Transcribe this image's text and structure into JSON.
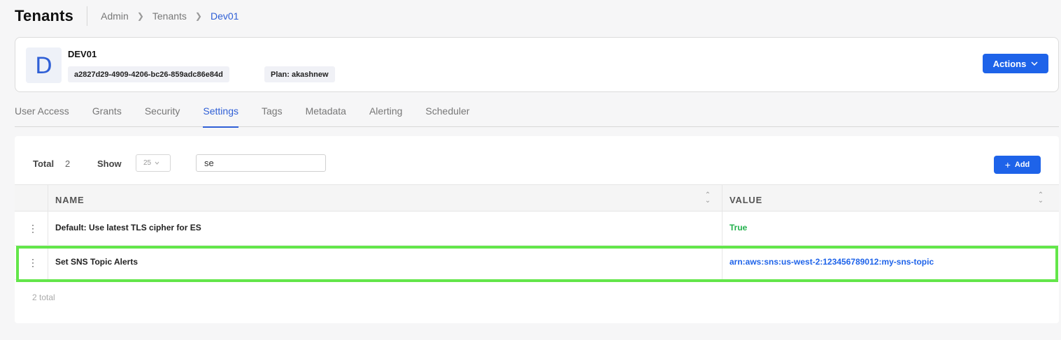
{
  "header": {
    "title": "Tenants",
    "breadcrumb": [
      "Admin",
      "Tenants",
      "Dev01"
    ]
  },
  "tenant": {
    "avatar_letter": "D",
    "name": "DEV01",
    "id": "a2827d29-4909-4206-bc26-859adc86e84d",
    "plan": "Plan: akashnew",
    "actions_label": "Actions"
  },
  "tabs": [
    {
      "label": "User Access",
      "active": false
    },
    {
      "label": "Grants",
      "active": false
    },
    {
      "label": "Security",
      "active": false
    },
    {
      "label": "Settings",
      "active": true
    },
    {
      "label": "Tags",
      "active": false
    },
    {
      "label": "Metadata",
      "active": false
    },
    {
      "label": "Alerting",
      "active": false
    },
    {
      "label": "Scheduler",
      "active": false
    }
  ],
  "toolbar": {
    "total_label": "Total",
    "total_value": "2",
    "show_label": "Show",
    "page_size": "25",
    "search_value": "se",
    "add_label": "Add"
  },
  "table": {
    "columns": [
      "NAME",
      "VALUE"
    ],
    "rows": [
      {
        "name": "Default: Use latest TLS cipher for ES",
        "value": "True"
      },
      {
        "name": "Set SNS Topic Alerts",
        "value": "arn:aws:sns:us-west-2:123456789012:my-sns-topic"
      }
    ],
    "footer": "2 total"
  },
  "colors": {
    "primary": "#1e63e9",
    "true_value": "#22b14c",
    "highlight": "#63e64a"
  }
}
